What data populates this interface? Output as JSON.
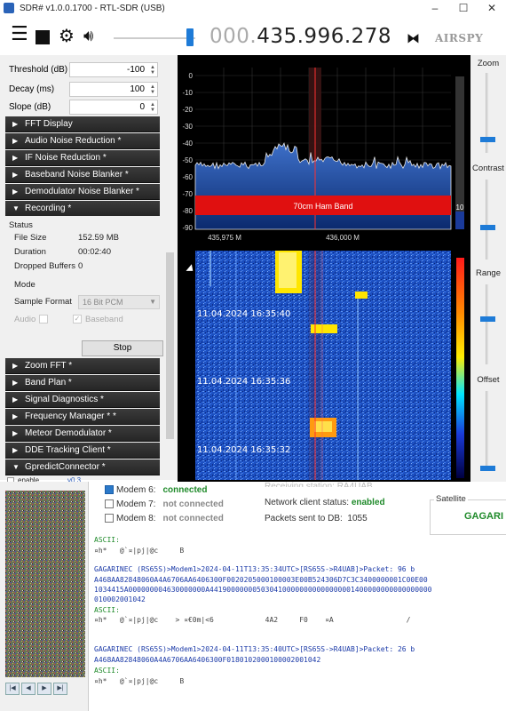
{
  "window": {
    "title": "SDR# v1.0.0.1700 - RTL-SDR (USB)",
    "controls": [
      "–",
      "☐",
      "✕"
    ]
  },
  "toolbar": {
    "frequency_dim": "000.",
    "frequency_main": "435.996.278",
    "logo": "AIRSPY"
  },
  "left": {
    "threshold": {
      "label": "Threshold (dB)",
      "value": "-100"
    },
    "decay": {
      "label": "Decay (ms)",
      "value": "100"
    },
    "slope": {
      "label": "Slope (dB)",
      "value": "0"
    },
    "sections_top": [
      "FFT Display",
      "Audio Noise Reduction *",
      "IF Noise Reduction *",
      "Baseband Noise Blanker *",
      "Demodulator Noise Blanker *"
    ],
    "recording": {
      "header": "Recording *",
      "status_title": "Status",
      "file_size_label": "File Size",
      "file_size": "152.59 MB",
      "duration_label": "Duration",
      "duration": "00:02:40",
      "dropped_label": "Dropped Buffers",
      "dropped": "0",
      "mode_title": "Mode",
      "sample_format_label": "Sample Format",
      "sample_format": "16 Bit PCM",
      "audio_label": "Audio",
      "baseband_label": "Baseband",
      "stop_label": "Stop"
    },
    "sections_bottom": [
      "Zoom FFT *",
      "Band Plan *",
      "Signal Diagnostics *",
      "Frequency Manager * *",
      "Meteor Demodulator *",
      "DDE Tracking Client *",
      "GpredictConnector *"
    ],
    "partial_row": "enable",
    "partial_version": "v0.3"
  },
  "spectrum": {
    "band_label": "70cm Ham Band",
    "y_ticks": [
      "0",
      "-10",
      "-20",
      "-30",
      "-40",
      "-50",
      "-60",
      "-70",
      "-80",
      "-90"
    ],
    "x_ticks": [
      "435,975 M",
      "436,000 M"
    ],
    "level_value": "10"
  },
  "waterfall": {
    "timestamps": [
      "11.04.2024 16:35:40",
      "11.04.2024 16:35:36",
      "11.04.2024 16:35:32"
    ]
  },
  "right": {
    "zoom": "Zoom",
    "contrast": "Contrast",
    "range": "Range",
    "offset": "Offset"
  },
  "bottom": {
    "modems": [
      {
        "name": "Modem 6:",
        "status": "connected",
        "on": true
      },
      {
        "name": "Modem 7:",
        "status": "not connected",
        "on": false
      },
      {
        "name": "Modem 8:",
        "status": "not connected",
        "on": false
      }
    ],
    "receiving_partial": "Receiving station: RA4UAB",
    "network_label": "Network client status:",
    "network_value": "enabled",
    "packets_label": "Packets sent to DB:",
    "packets_value": "1055",
    "satellite_legend": "Satellite",
    "satellite_value": "GAGARI",
    "log": [
      {
        "cls": "green",
        "text": "ASCII:"
      },
      {
        "cls": "gray",
        "text": "¤h*   @`¤|pj|@c     B"
      },
      {
        "cls": "blue",
        "text": "GAGARINEC (RS65S)>Modem1>2024-04-11T13:35:34UTC>[RS65S->R4UAB]>Packet: 96 b"
      },
      {
        "cls": "blue",
        "text": "A468AA82848060A4A6706AA6406300F0020205000100003E00B524306D7C3C3400000001C00E00"
      },
      {
        "cls": "blue",
        "text": "1034415A000000004630000000A4419000000050304100000000000000001400000000000000000"
      },
      {
        "cls": "blue",
        "text": "010002001042"
      },
      {
        "cls": "green",
        "text": "ASCII:"
      },
      {
        "cls": "gray",
        "text": "¤h*   @`¤|pj|@c    > ¤€0m|<6            4A2     F0    ¤A                 /"
      },
      {
        "cls": "blue",
        "text": ""
      },
      {
        "cls": "blue",
        "text": "GAGARINEC (RS65S)>Modem1>2024-04-11T13:35:40UTC>[RS65S->R4UAB]>Packet: 26 b"
      },
      {
        "cls": "blue",
        "text": "A468AA82848060A4A6706AA6406300F0180102000100002001042"
      },
      {
        "cls": "green",
        "text": "ASCII:"
      },
      {
        "cls": "gray",
        "text": "¤h*   @`¤|pj|@c     B"
      }
    ]
  }
}
